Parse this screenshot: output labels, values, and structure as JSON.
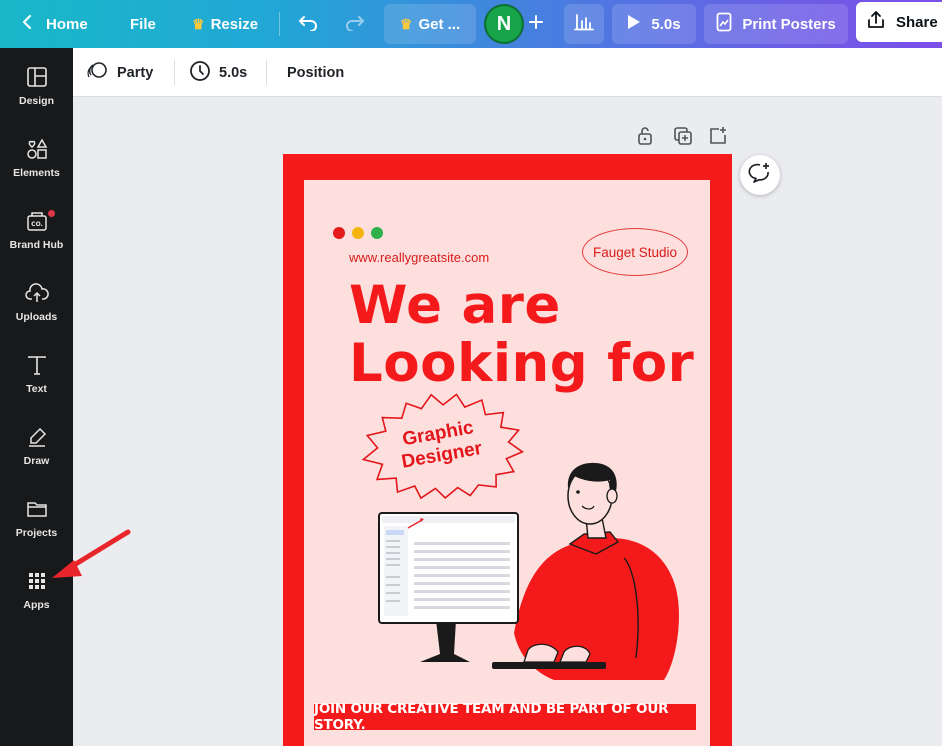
{
  "topbar": {
    "home_label": "Home",
    "file_label": "File",
    "resize_label": "Resize",
    "get_label": "Get ...",
    "avatar_initial": "N",
    "play_label": "5.0s",
    "print_label": "Print Posters",
    "share_label": "Share"
  },
  "sidebar": {
    "items": [
      {
        "label": "Design",
        "icon": "design-icon"
      },
      {
        "label": "Elements",
        "icon": "elements-icon"
      },
      {
        "label": "Brand Hub",
        "icon": "brand-hub-icon"
      },
      {
        "label": "Uploads",
        "icon": "upload-icon"
      },
      {
        "label": "Text",
        "icon": "text-icon"
      },
      {
        "label": "Draw",
        "icon": "draw-icon"
      },
      {
        "label": "Projects",
        "icon": "folder-icon"
      },
      {
        "label": "Apps",
        "icon": "apps-grid-icon"
      }
    ]
  },
  "context_toolbar": {
    "animation_label": "Party",
    "duration_label": "5.0s",
    "position_label": "Position"
  },
  "poster": {
    "website": "www.reallygreatsite.com",
    "studio": "Fauget Studio",
    "headline_line1": "We are",
    "headline_line2": "Looking for",
    "badge_line1": "Graphic",
    "badge_line2": "Designer",
    "cta": "JOIN OUR CREATIVE TEAM AND BE PART OF OUR STORY."
  },
  "colors": {
    "poster_red": "#f41a1b",
    "poster_pink": "#fde0dd",
    "sidebar_bg": "#18191b",
    "avatar_green": "#16a34a",
    "arrow_red": "#e8252b"
  }
}
